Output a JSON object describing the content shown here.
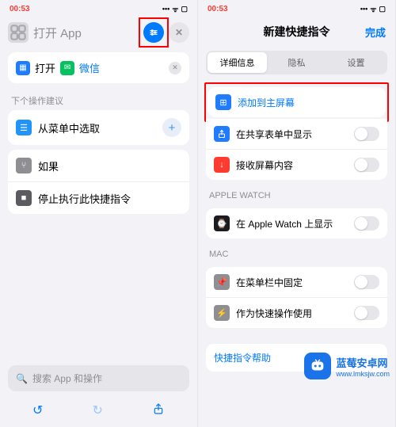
{
  "status": {
    "time": "00:53",
    "signal": "•••",
    "wifi": "ᯤ",
    "battery": "▢"
  },
  "left": {
    "title": "打开 App",
    "action_card": {
      "open_label": "打开",
      "app_name": "微信"
    },
    "suggestions_header": "下个操作建议",
    "suggestions": [
      {
        "icon": "menu",
        "label": "从菜单中选取"
      },
      {
        "icon": "if",
        "label": "如果"
      },
      {
        "icon": "stop",
        "label": "停止执行此快捷指令"
      }
    ],
    "search_placeholder": "搜索 App 和操作",
    "toolbar": {
      "undo": "↺",
      "redo": "↻",
      "share": "⇧"
    }
  },
  "right": {
    "title": "新建快捷指令",
    "done": "完成",
    "tabs": [
      "详细信息",
      "隐私",
      "设置"
    ],
    "group1": [
      {
        "icon": "plus",
        "label": "添加到主屏幕",
        "link": true,
        "highlight": true
      },
      {
        "icon": "share",
        "label": "在共享表单中显示",
        "toggle": true
      },
      {
        "icon": "receive",
        "label": "接收屏幕内容",
        "toggle": true
      }
    ],
    "group2_header": "APPLE WATCH",
    "group2": [
      {
        "icon": "watch",
        "label": "在 Apple Watch 上显示",
        "toggle": true
      }
    ],
    "group3_header": "MAC",
    "group3": [
      {
        "icon": "pin",
        "label": "在菜单栏中固定",
        "toggle": true
      },
      {
        "icon": "quick",
        "label": "作为快速操作使用",
        "toggle": true
      }
    ],
    "help": "快捷指令帮助"
  },
  "watermark": {
    "title": "蓝莓安卓网",
    "url": "www.lmksjw.com"
  }
}
